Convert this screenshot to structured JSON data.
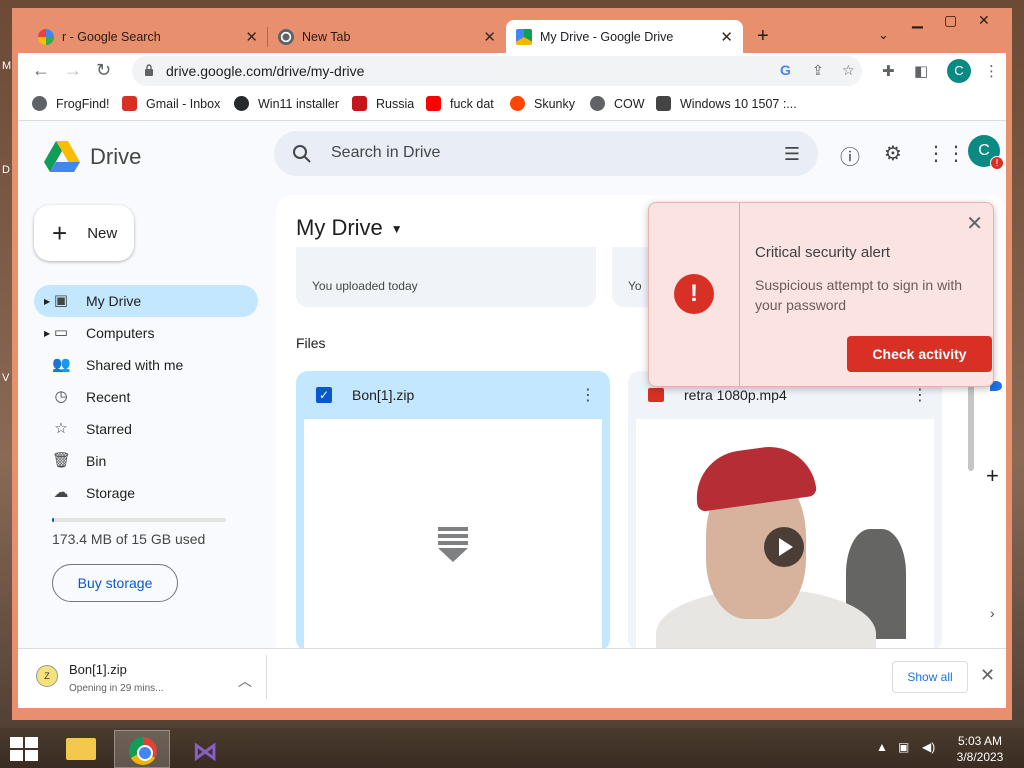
{
  "browser": {
    "tabs": [
      {
        "label": "r - Google Search",
        "favicon": "google-g-icon"
      },
      {
        "label": "New Tab",
        "favicon": "chrome-icon"
      },
      {
        "label": "My Drive - Google Drive",
        "favicon": "drive-icon"
      }
    ],
    "new_tab_symbol": "+",
    "url": "drive.google.com/drive/my-drive",
    "profile_initial": "C"
  },
  "bookmarks": [
    {
      "label": "FrogFind!",
      "icon": "globe-icon",
      "color": "#5f6368"
    },
    {
      "label": "Gmail - Inbox",
      "icon": "gmail-icon",
      "color": "#d93025"
    },
    {
      "label": "Win11 installer",
      "icon": "github-icon",
      "color": "#24292e"
    },
    {
      "label": "Russia",
      "icon": "bookmark-red-icon",
      "color": "#c4161c"
    },
    {
      "label": "fuck dat",
      "icon": "youtube-icon",
      "color": "#ff0000"
    },
    {
      "label": "Skunky",
      "icon": "reddit-icon",
      "color": "#ff4500"
    },
    {
      "label": "COW",
      "icon": "globe-icon",
      "color": "#5f6368"
    },
    {
      "label": "Windows 10 1507 :...",
      "icon": "archive-icon",
      "color": "#444444"
    }
  ],
  "drive": {
    "brand": "Drive",
    "search_placeholder": "Search in Drive",
    "avatar_initial": "C",
    "avatar_badge": "!",
    "new_label": "New",
    "nav": [
      {
        "label": "My Drive",
        "icon": "my-drive-icon",
        "selected": true,
        "caret": true
      },
      {
        "label": "Computers",
        "icon": "computers-icon",
        "selected": false,
        "caret": true
      },
      {
        "label": "Shared with me",
        "icon": "people-icon",
        "selected": false,
        "caret": false
      },
      {
        "label": "Recent",
        "icon": "clock-icon",
        "selected": false,
        "caret": false
      },
      {
        "label": "Starred",
        "icon": "star-icon",
        "selected": false,
        "caret": false
      },
      {
        "label": "Bin",
        "icon": "trash-icon",
        "selected": false,
        "caret": false
      },
      {
        "label": "Storage",
        "icon": "cloud-icon",
        "selected": false,
        "caret": false
      }
    ],
    "storage_text": "173.4 MB of 15 GB used",
    "storage_fraction": 0.012,
    "buy_storage_label": "Buy storage",
    "title": "My Drive",
    "suggested": [
      {
        "text": "You uploaded today"
      },
      {
        "text": "Yo"
      }
    ],
    "files_header": "Files",
    "files": [
      {
        "name": "Bon[1].zip",
        "selected": true,
        "type": "zip"
      },
      {
        "name": "retra 1080p.mp4",
        "selected": false,
        "type": "video"
      }
    ]
  },
  "alert": {
    "title": "Critical security alert",
    "body": "Suspicious attempt to sign in with your password",
    "button": "Check activity",
    "accent": "#d93025"
  },
  "downloads": {
    "file": "Bon[1].zip",
    "status": "Opening in 29 mins...",
    "show_all": "Show all"
  },
  "taskbar": {
    "time": "5:03 AM",
    "date": "3/8/2023"
  }
}
